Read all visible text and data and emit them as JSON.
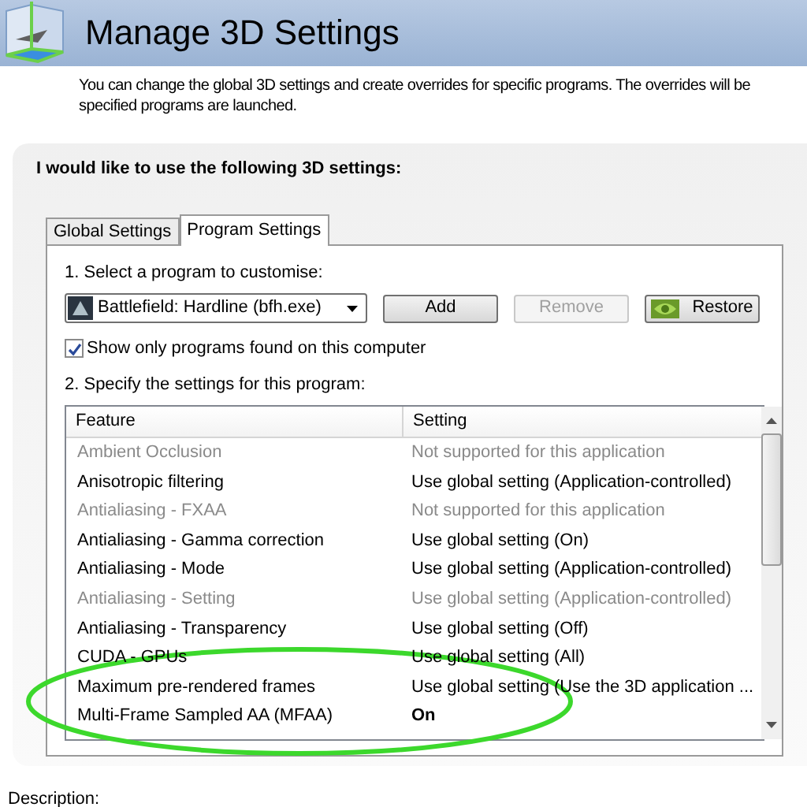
{
  "header": {
    "title": "Manage 3D Settings"
  },
  "intro_lines": [
    "You can change the global 3D settings and create overrides for specific programs. The overrides will be",
    "specified programs are launched."
  ],
  "panel": {
    "heading": "I would like to use the following 3D settings:"
  },
  "tabs": [
    {
      "label": "Global Settings",
      "selected": false
    },
    {
      "label": "Program Settings",
      "selected": true
    }
  ],
  "step1": {
    "label": "1. Select a program to customise:",
    "program": "Battlefield: Hardline (bfh.exe)"
  },
  "buttons": [
    {
      "label": "Add",
      "disabled": false,
      "kind": "plain"
    },
    {
      "label": "Remove",
      "disabled": true,
      "kind": "plain"
    },
    {
      "label": "Restore",
      "disabled": false,
      "kind": "logo"
    }
  ],
  "show_only": {
    "label": "Show only programs found on this computer",
    "checked": true
  },
  "step2": {
    "label": "2. Specify the settings for this program:"
  },
  "table": {
    "columns": [
      "Feature",
      "Setting"
    ],
    "rows": [
      {
        "feature": "Ambient Occlusion",
        "setting": "Not supported for this application",
        "disabled": true,
        "modified": false
      },
      {
        "feature": "Anisotropic filtering",
        "setting": "Use global setting (Application-controlled)",
        "disabled": false,
        "modified": false
      },
      {
        "feature": "Antialiasing - FXAA",
        "setting": "Not supported for this application",
        "disabled": true,
        "modified": false
      },
      {
        "feature": "Antialiasing - Gamma correction",
        "setting": "Use global setting (On)",
        "disabled": false,
        "modified": false
      },
      {
        "feature": "Antialiasing - Mode",
        "setting": "Use global setting (Application-controlled)",
        "disabled": false,
        "modified": false
      },
      {
        "feature": "Antialiasing - Setting",
        "setting": "Use global setting (Application-controlled)",
        "disabled": true,
        "modified": false
      },
      {
        "feature": "Antialiasing - Transparency",
        "setting": "Use global setting (Off)",
        "disabled": false,
        "modified": false
      },
      {
        "feature": "CUDA - GPUs",
        "setting": "Use global setting (All)",
        "disabled": false,
        "modified": false
      },
      {
        "feature": "Maximum pre-rendered frames",
        "setting": "Use global setting (Use the 3D application ...",
        "disabled": false,
        "modified": false
      },
      {
        "feature": "Multi-Frame Sampled AA (MFAA)",
        "setting": "On",
        "disabled": false,
        "modified": true
      }
    ]
  },
  "description": {
    "label": "Description:"
  }
}
